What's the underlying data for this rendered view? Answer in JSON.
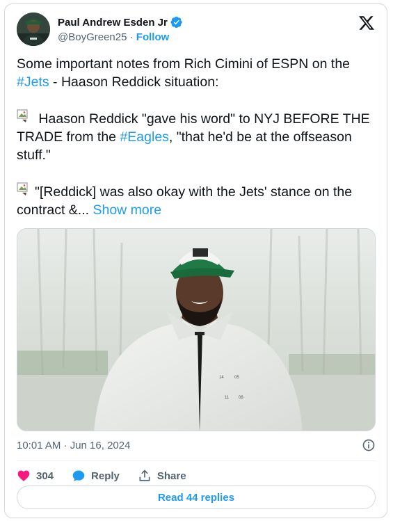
{
  "author": {
    "name": "Paul Andrew Esden Jr",
    "handle": "@BoyGreen25",
    "separator": "·",
    "follow_label": "Follow"
  },
  "tweet": {
    "line1_prefix": "Some important notes from Rich Cimini of ESPN on the",
    "hashtag_jets": "#Jets",
    "line1_suffix": " - Haason Reddick situation:",
    "para2_prefix": " Haason Reddick \"gave his word\" to NYJ BEFORE THE TRADE from the ",
    "hashtag_eagles": "#Eagles",
    "para2_suffix": ", \"that he'd be at the offseason stuff.\"",
    "para3_text": "\"[Reddick] was also okay with the Jets' stance on the contract &... ",
    "show_more": "Show more"
  },
  "meta": {
    "timestamp": "10:01 AM · Jun 16, 2024"
  },
  "actions": {
    "likes_count": "304",
    "reply_label": "Reply",
    "share_label": "Share"
  },
  "replies_button": "Read 44 replies",
  "colors": {
    "accent": "#1d9bf0",
    "like": "#f91880",
    "text": "#0f1419",
    "muted": "#536471"
  },
  "icons": [
    "verified-badge-icon",
    "x-logo-icon",
    "broken-image-icon",
    "info-icon",
    "heart-icon",
    "reply-bubble-icon",
    "share-icon"
  ]
}
